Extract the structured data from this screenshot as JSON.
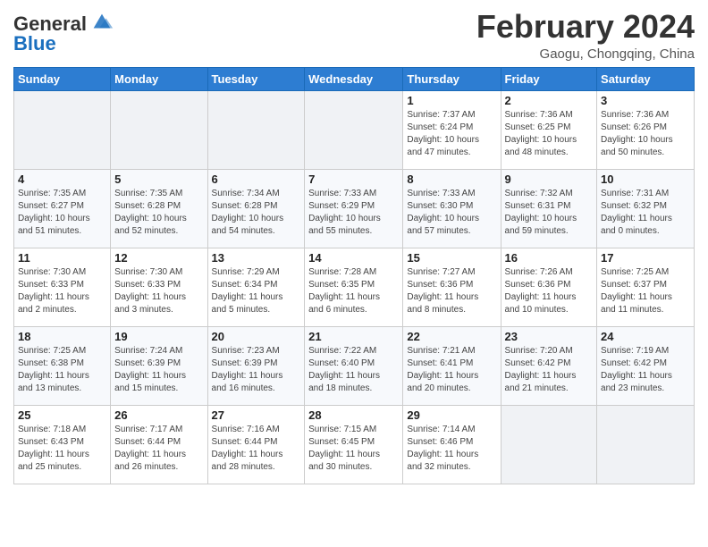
{
  "header": {
    "logo_line1": "General",
    "logo_line2": "Blue",
    "month_year": "February 2024",
    "location": "Gaogu, Chongqing, China"
  },
  "weekdays": [
    "Sunday",
    "Monday",
    "Tuesday",
    "Wednesday",
    "Thursday",
    "Friday",
    "Saturday"
  ],
  "weeks": [
    [
      {
        "day": "",
        "info": ""
      },
      {
        "day": "",
        "info": ""
      },
      {
        "day": "",
        "info": ""
      },
      {
        "day": "",
        "info": ""
      },
      {
        "day": "1",
        "info": "Sunrise: 7:37 AM\nSunset: 6:24 PM\nDaylight: 10 hours\nand 47 minutes."
      },
      {
        "day": "2",
        "info": "Sunrise: 7:36 AM\nSunset: 6:25 PM\nDaylight: 10 hours\nand 48 minutes."
      },
      {
        "day": "3",
        "info": "Sunrise: 7:36 AM\nSunset: 6:26 PM\nDaylight: 10 hours\nand 50 minutes."
      }
    ],
    [
      {
        "day": "4",
        "info": "Sunrise: 7:35 AM\nSunset: 6:27 PM\nDaylight: 10 hours\nand 51 minutes."
      },
      {
        "day": "5",
        "info": "Sunrise: 7:35 AM\nSunset: 6:28 PM\nDaylight: 10 hours\nand 52 minutes."
      },
      {
        "day": "6",
        "info": "Sunrise: 7:34 AM\nSunset: 6:28 PM\nDaylight: 10 hours\nand 54 minutes."
      },
      {
        "day": "7",
        "info": "Sunrise: 7:33 AM\nSunset: 6:29 PM\nDaylight: 10 hours\nand 55 minutes."
      },
      {
        "day": "8",
        "info": "Sunrise: 7:33 AM\nSunset: 6:30 PM\nDaylight: 10 hours\nand 57 minutes."
      },
      {
        "day": "9",
        "info": "Sunrise: 7:32 AM\nSunset: 6:31 PM\nDaylight: 10 hours\nand 59 minutes."
      },
      {
        "day": "10",
        "info": "Sunrise: 7:31 AM\nSunset: 6:32 PM\nDaylight: 11 hours\nand 0 minutes."
      }
    ],
    [
      {
        "day": "11",
        "info": "Sunrise: 7:30 AM\nSunset: 6:33 PM\nDaylight: 11 hours\nand 2 minutes."
      },
      {
        "day": "12",
        "info": "Sunrise: 7:30 AM\nSunset: 6:33 PM\nDaylight: 11 hours\nand 3 minutes."
      },
      {
        "day": "13",
        "info": "Sunrise: 7:29 AM\nSunset: 6:34 PM\nDaylight: 11 hours\nand 5 minutes."
      },
      {
        "day": "14",
        "info": "Sunrise: 7:28 AM\nSunset: 6:35 PM\nDaylight: 11 hours\nand 6 minutes."
      },
      {
        "day": "15",
        "info": "Sunrise: 7:27 AM\nSunset: 6:36 PM\nDaylight: 11 hours\nand 8 minutes."
      },
      {
        "day": "16",
        "info": "Sunrise: 7:26 AM\nSunset: 6:36 PM\nDaylight: 11 hours\nand 10 minutes."
      },
      {
        "day": "17",
        "info": "Sunrise: 7:25 AM\nSunset: 6:37 PM\nDaylight: 11 hours\nand 11 minutes."
      }
    ],
    [
      {
        "day": "18",
        "info": "Sunrise: 7:25 AM\nSunset: 6:38 PM\nDaylight: 11 hours\nand 13 minutes."
      },
      {
        "day": "19",
        "info": "Sunrise: 7:24 AM\nSunset: 6:39 PM\nDaylight: 11 hours\nand 15 minutes."
      },
      {
        "day": "20",
        "info": "Sunrise: 7:23 AM\nSunset: 6:39 PM\nDaylight: 11 hours\nand 16 minutes."
      },
      {
        "day": "21",
        "info": "Sunrise: 7:22 AM\nSunset: 6:40 PM\nDaylight: 11 hours\nand 18 minutes."
      },
      {
        "day": "22",
        "info": "Sunrise: 7:21 AM\nSunset: 6:41 PM\nDaylight: 11 hours\nand 20 minutes."
      },
      {
        "day": "23",
        "info": "Sunrise: 7:20 AM\nSunset: 6:42 PM\nDaylight: 11 hours\nand 21 minutes."
      },
      {
        "day": "24",
        "info": "Sunrise: 7:19 AM\nSunset: 6:42 PM\nDaylight: 11 hours\nand 23 minutes."
      }
    ],
    [
      {
        "day": "25",
        "info": "Sunrise: 7:18 AM\nSunset: 6:43 PM\nDaylight: 11 hours\nand 25 minutes."
      },
      {
        "day": "26",
        "info": "Sunrise: 7:17 AM\nSunset: 6:44 PM\nDaylight: 11 hours\nand 26 minutes."
      },
      {
        "day": "27",
        "info": "Sunrise: 7:16 AM\nSunset: 6:44 PM\nDaylight: 11 hours\nand 28 minutes."
      },
      {
        "day": "28",
        "info": "Sunrise: 7:15 AM\nSunset: 6:45 PM\nDaylight: 11 hours\nand 30 minutes."
      },
      {
        "day": "29",
        "info": "Sunrise: 7:14 AM\nSunset: 6:46 PM\nDaylight: 11 hours\nand 32 minutes."
      },
      {
        "day": "",
        "info": ""
      },
      {
        "day": "",
        "info": ""
      }
    ]
  ]
}
